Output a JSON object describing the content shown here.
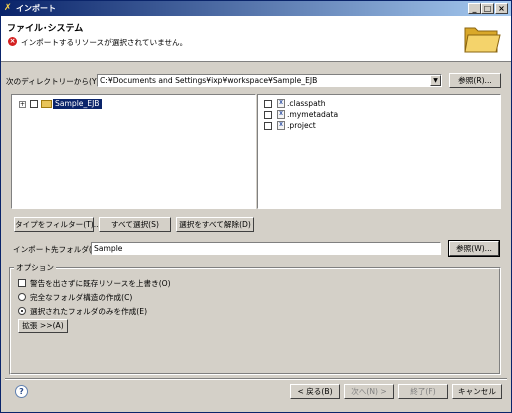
{
  "window": {
    "title": "インポート"
  },
  "header": {
    "title": "ファイル･システム",
    "message": "インポートするリソースが選択されていません。"
  },
  "source": {
    "label": "次のディレクトリーから(Y):",
    "value": "C:¥Documents and Settings¥ixp¥workspace¥Sample_EJB",
    "browse_label": "参照(R)..."
  },
  "tree": {
    "items": [
      {
        "label": "Sample_EJB",
        "selected": true
      }
    ]
  },
  "files": {
    "items": [
      {
        "label": ".classpath"
      },
      {
        "label": ".mymetadata"
      },
      {
        "label": ".project"
      }
    ]
  },
  "actions": {
    "filter_label": "タイプをフィルター(T)...",
    "select_all_label": "すべて選択(S)",
    "deselect_all_label": "選択をすべて解除(D)"
  },
  "dest": {
    "label": "インポート先フォルダ(L):",
    "value": "Sample",
    "browse_label": "参照(W)..."
  },
  "options": {
    "group_label": "オプション",
    "overwrite_label": "警告を出さずに既存リソースを上書き(O)",
    "full_structure_label": "完全なフォルダ構造の作成(C)",
    "selected_only_label": "選択されたフォルダのみを作成(E)",
    "advanced_label": "拡張 >>(A)"
  },
  "footer": {
    "help_label": "?",
    "back_label": "< 戻る(B)",
    "next_label": "次へ(N) >",
    "finish_label": "終了(F)",
    "cancel_label": "キャンセル"
  }
}
